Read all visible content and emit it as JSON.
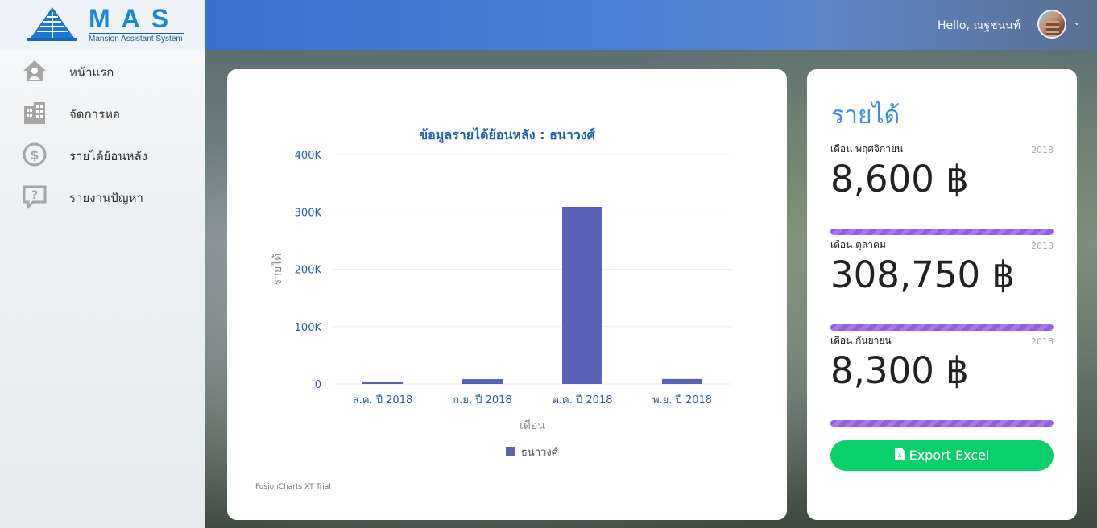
{
  "app": {
    "logo_text": "MAS",
    "logo_subtitle": "Mansion Assistant System"
  },
  "header": {
    "greeting": "Hello, ณฐชนนท์",
    "menu_caret": "⌄"
  },
  "sidebar": {
    "items": [
      {
        "label": "หน้าแรก",
        "icon": "home-icon"
      },
      {
        "label": "จัดการหอ",
        "icon": "building-icon"
      },
      {
        "label": "รายได้ย้อนหลัง",
        "icon": "dollar-icon"
      },
      {
        "label": "รายงานปัญหา",
        "icon": "question-chat-icon"
      }
    ]
  },
  "chart_card": {
    "trial_note": "FusionCharts XT Trial"
  },
  "chart_data": {
    "type": "bar",
    "title": "ข้อมูลรายได้ย้อนหลัง : ธนาวงศ์",
    "xlabel": "เดือน",
    "ylabel": "รายได้",
    "categories": [
      "ส.ค. ปี 2018",
      "ก.ย. ปี 2018",
      "ต.ค. ปี 2018",
      "พ.ย. ปี 2018"
    ],
    "series": [
      {
        "name": "ธนาวงศ์",
        "values": [
          3500,
          8300,
          308750,
          8600
        ]
      }
    ],
    "ylim": [
      0,
      400000
    ],
    "yticks": [
      "0",
      "100K",
      "200K",
      "300K",
      "400K"
    ],
    "grid": true,
    "legend": "bottom-center",
    "bar_color": "#5b61b5"
  },
  "revenue": {
    "title": "รายได้",
    "entries": [
      {
        "month": "เดือน พฤศจิกายน",
        "year": "2018",
        "amount": "8,600 ฿"
      },
      {
        "month": "เดือน ตุลาคม",
        "year": "2018",
        "amount": "308,750 ฿"
      },
      {
        "month": "เดือน กันยายน",
        "year": "2018",
        "amount": "8,300 ฿"
      }
    ],
    "export_label": "Export Excel"
  }
}
